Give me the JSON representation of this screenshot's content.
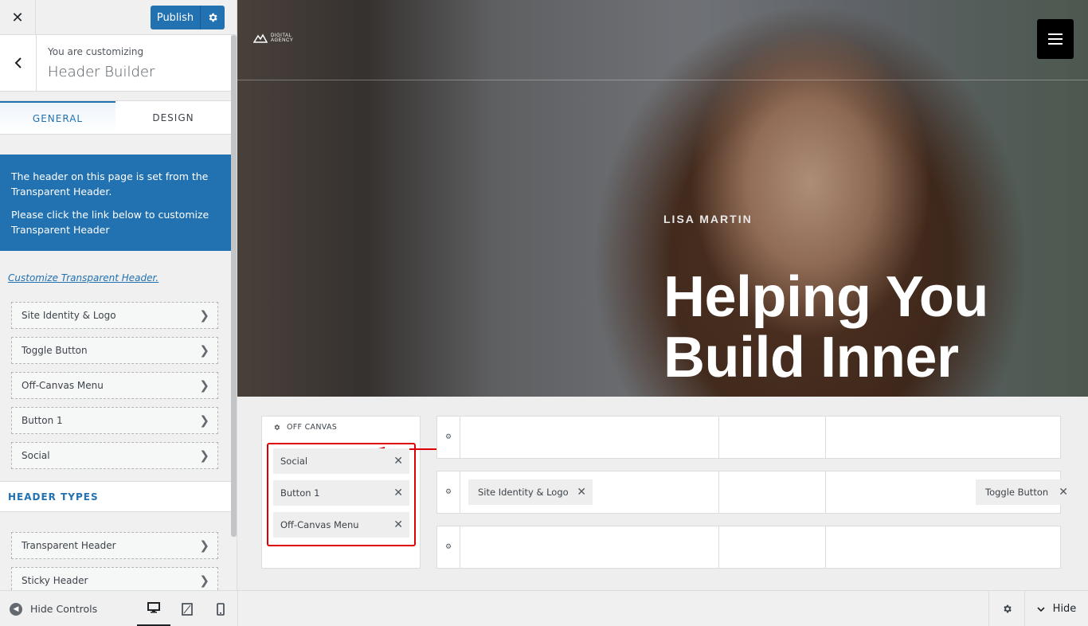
{
  "topbar": {
    "close_label": "✕",
    "publish_label": "Publish"
  },
  "panel": {
    "customizing_label": "You are customizing",
    "title": "Header Builder"
  },
  "tabs": [
    {
      "label": "GENERAL",
      "active": true
    },
    {
      "label": "DESIGN",
      "active": false
    }
  ],
  "notice": {
    "line1": "The header on this page is set from the Transparent Header.",
    "line2": "Please click the link below to customize Transparent Header"
  },
  "customize_link": "Customize Transparent Header.",
  "components": [
    {
      "label": "Site Identity & Logo"
    },
    {
      "label": "Toggle Button"
    },
    {
      "label": "Off-Canvas Menu"
    },
    {
      "label": "Button 1"
    },
    {
      "label": "Social"
    }
  ],
  "header_types": {
    "title": "HEADER TYPES",
    "items": [
      {
        "label": "Transparent Header"
      },
      {
        "label": "Sticky Header"
      }
    ]
  },
  "bottombar": {
    "hide_controls_label": "Hide Controls",
    "hide_label": "Hide"
  },
  "hero": {
    "logo_line1": "DIGITAL",
    "logo_line2": "AGENCY",
    "name": "LISA MARTIN",
    "heading": "Helping You Build Inner"
  },
  "builder": {
    "offcanvas_label": "OFF CANVAS",
    "offcanvas_items": [
      {
        "label": "Social"
      },
      {
        "label": "Button 1"
      },
      {
        "label": "Off-Canvas Menu"
      }
    ],
    "middle_row": {
      "left_item": "Site Identity & Logo",
      "right_item": "Toggle Button"
    }
  },
  "colors": {
    "accent": "#2271b1",
    "highlight": "#e00000",
    "panel_bg": "#f0f0f1"
  }
}
